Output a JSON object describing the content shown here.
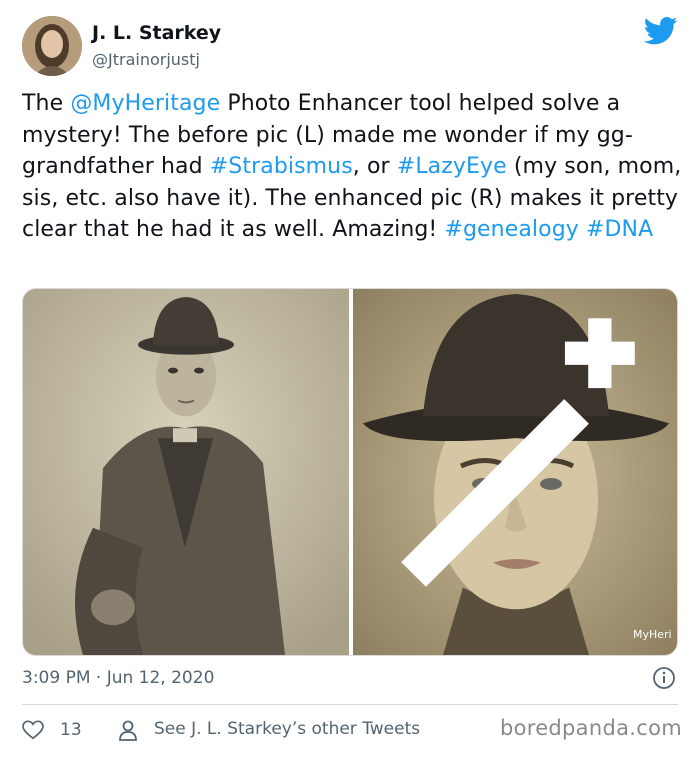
{
  "user": {
    "name": "J. L. Starkey",
    "handle": "@Jtrainorjustj",
    "avatar_icon": "user-avatar"
  },
  "tweet": {
    "segments": [
      {
        "text": "The ",
        "type": "plain"
      },
      {
        "text": "@MyHeritage",
        "type": "mention"
      },
      {
        "text": " Photo Enhancer tool helped solve a mystery! The before pic (L) made me wonder if my gg-grandfather had ",
        "type": "plain"
      },
      {
        "text": "#Strabismus",
        "type": "hashtag"
      },
      {
        "text": ", or ",
        "type": "plain"
      },
      {
        "text": "#LazyEye",
        "type": "hashtag"
      },
      {
        "text": " (my son, mom, sis, etc. also have it). The enhanced pic (R) makes it pretty clear that he had it as well. Amazing! ",
        "type": "plain"
      },
      {
        "text": "#genealogy",
        "type": "hashtag"
      },
      {
        "text": " ",
        "type": "plain"
      },
      {
        "text": "#DNA",
        "type": "hashtag"
      }
    ],
    "link_color": "#1d9bf0"
  },
  "media": {
    "left_photo": "before-photo",
    "right_photo": "enhanced-photo",
    "watermark": "MyHeri"
  },
  "meta": {
    "timestamp": "3:09 PM · Jun 12, 2020"
  },
  "actions": {
    "like_count": "13",
    "see_more": "See J. L. Starkey’s other Tweets"
  },
  "branding": {
    "site": "boredpanda.com"
  },
  "colors": {
    "twitter_blue": "#1d9bf0",
    "secondary_text": "#536471"
  }
}
